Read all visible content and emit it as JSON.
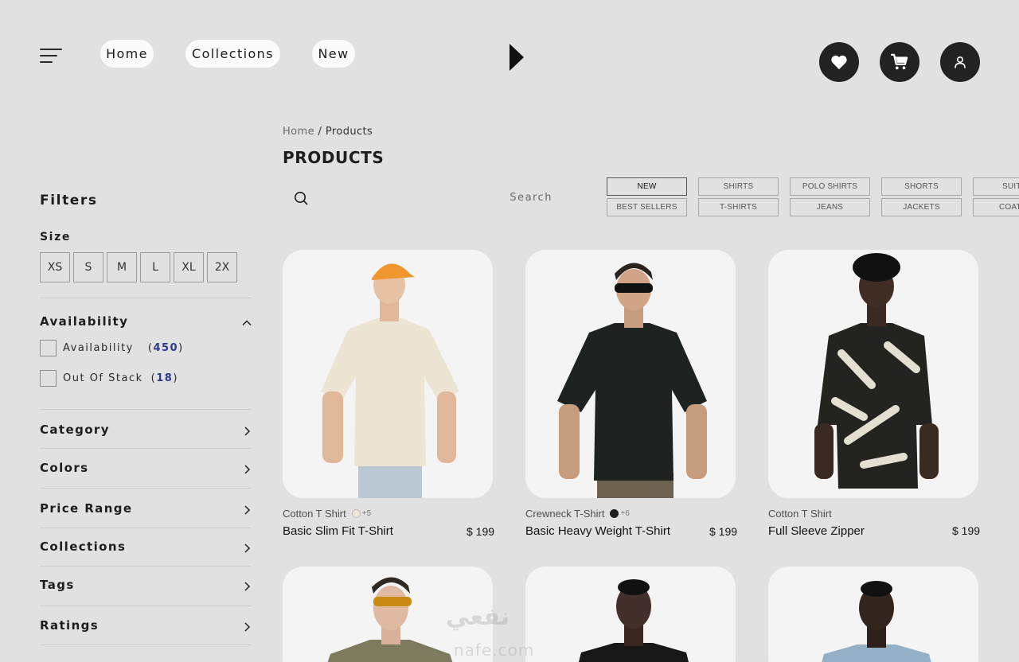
{
  "header": {
    "nav": [
      "Home",
      "Collections",
      "New"
    ]
  },
  "breadcrumb": {
    "home": "Home",
    "separator": "/",
    "current": "Products"
  },
  "page_title": "PRODUCTS",
  "search": {
    "placeholder": "Search"
  },
  "categories": {
    "row1": [
      "NEW",
      "SHIRTS",
      "POLO SHIRTS",
      "SHORTS",
      "SUIT"
    ],
    "row2": [
      "BEST SELLERS",
      "T-SHIRTS",
      "JEANS",
      "JACKETS",
      "COAT"
    ],
    "active": "NEW"
  },
  "sidebar": {
    "filters_title": "Filters",
    "size_title": "Size",
    "sizes": [
      "XS",
      "S",
      "M",
      "L",
      "XL",
      "2X"
    ],
    "availability": {
      "title": "Availability",
      "options": [
        {
          "label": "Availability",
          "count": "450"
        },
        {
          "label": "Out Of Stack",
          "count": "18"
        }
      ]
    },
    "groups": [
      "Category",
      "Colors",
      "Price Range",
      "Collections",
      "Tags",
      "Ratings"
    ]
  },
  "products": [
    {
      "subtitle": "Cotton T Shirt",
      "swatch": "#efe9d8",
      "more": "+5",
      "name": "Basic Slim Fit T-Shirt",
      "price": "$ 199"
    },
    {
      "subtitle": "Crewneck T-Shirt",
      "swatch": "#1f1f1f",
      "more": "+6",
      "name": "Basic Heavy Weight T-Shirt",
      "price": "$ 199"
    },
    {
      "subtitle": "Cotton T Shirt",
      "swatch": "",
      "more": "",
      "name": "Full Sleeve Zipper",
      "price": "$ 199"
    }
  ],
  "watermark": {
    "arabic": "نفعي",
    "latin": "nafe.com"
  },
  "colors": {
    "dark_button": "#222222",
    "count_accent": "#2b3a8f",
    "background": "#e1e1e1"
  },
  "icons": [
    "menu-icon",
    "logo-icon",
    "heart-icon",
    "cart-icon",
    "user-icon",
    "search-icon",
    "chevron-up-icon",
    "chevron-right-icon"
  ]
}
